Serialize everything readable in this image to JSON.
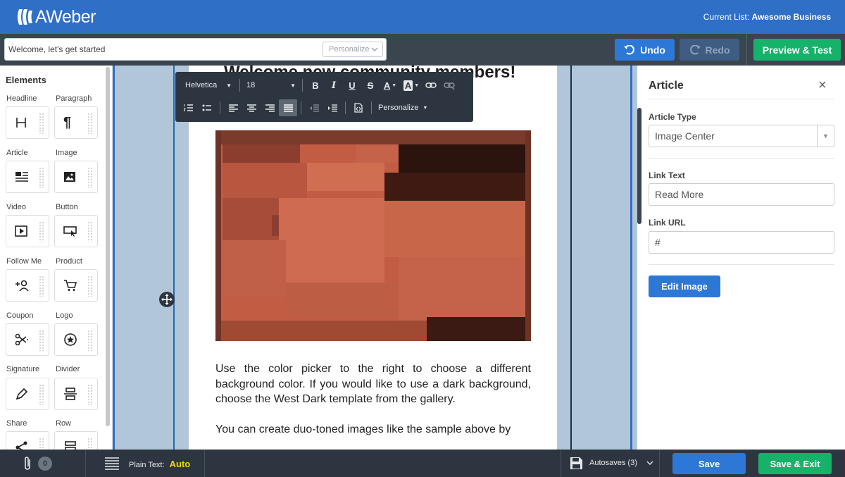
{
  "header": {
    "app_name": "AWeber",
    "current_list_label": "Current List:",
    "current_list_value": "Awesome Business"
  },
  "toolbar": {
    "subject_value": "Welcome, let's get started",
    "personalize_label": "Personalize",
    "undo_label": "Undo",
    "redo_label": "Redo",
    "preview_label": "Preview & Test"
  },
  "elements": {
    "title": "Elements",
    "items": [
      {
        "label": "Headline",
        "icon": "headline-icon"
      },
      {
        "label": "Paragraph",
        "icon": "paragraph-icon"
      },
      {
        "label": "Article",
        "icon": "article-icon"
      },
      {
        "label": "Image",
        "icon": "image-icon"
      },
      {
        "label": "Video",
        "icon": "video-icon"
      },
      {
        "label": "Button",
        "icon": "button-icon"
      },
      {
        "label": "Follow Me",
        "icon": "follow-me-icon"
      },
      {
        "label": "Product",
        "icon": "cart-icon"
      },
      {
        "label": "Coupon",
        "icon": "scissors-icon"
      },
      {
        "label": "Logo",
        "icon": "star-badge-icon"
      },
      {
        "label": "Signature",
        "icon": "pen-icon"
      },
      {
        "label": "Divider",
        "icon": "divider-icon"
      },
      {
        "label": "Share",
        "icon": "share-icon"
      },
      {
        "label": "Row",
        "icon": "row-icon"
      }
    ]
  },
  "editor": {
    "heading": "Welcome new community members!",
    "paragraph_1": "Use the color picker to the right to choose a different background color. If you would like to use a dark background, choose the West Dark template from the gallery.",
    "paragraph_2": "You can create duo-toned images like the sample above by",
    "format_bar": {
      "font": "Helvetica",
      "size": "18",
      "personalize": "Personalize"
    }
  },
  "article_panel": {
    "title": "Article",
    "type_label": "Article Type",
    "type_value": "Image Center",
    "link_text_label": "Link Text",
    "link_text_value": "Read More",
    "link_url_label": "Link URL",
    "link_url_value": "#",
    "edit_image_label": "Edit Image"
  },
  "footer": {
    "attachments_count": "0",
    "plain_text_label": "Plain Text:",
    "plain_text_value": "Auto",
    "autosaves_label": "Autosaves (3)",
    "save_label": "Save",
    "save_exit_label": "Save & Exit"
  },
  "colors": {
    "brand_blue": "#2f6fc6",
    "dark_bar": "#3a4550",
    "green": "#17b26a",
    "canvas_bg": "#b1c6d8",
    "auto_yellow": "#f2d21a"
  }
}
